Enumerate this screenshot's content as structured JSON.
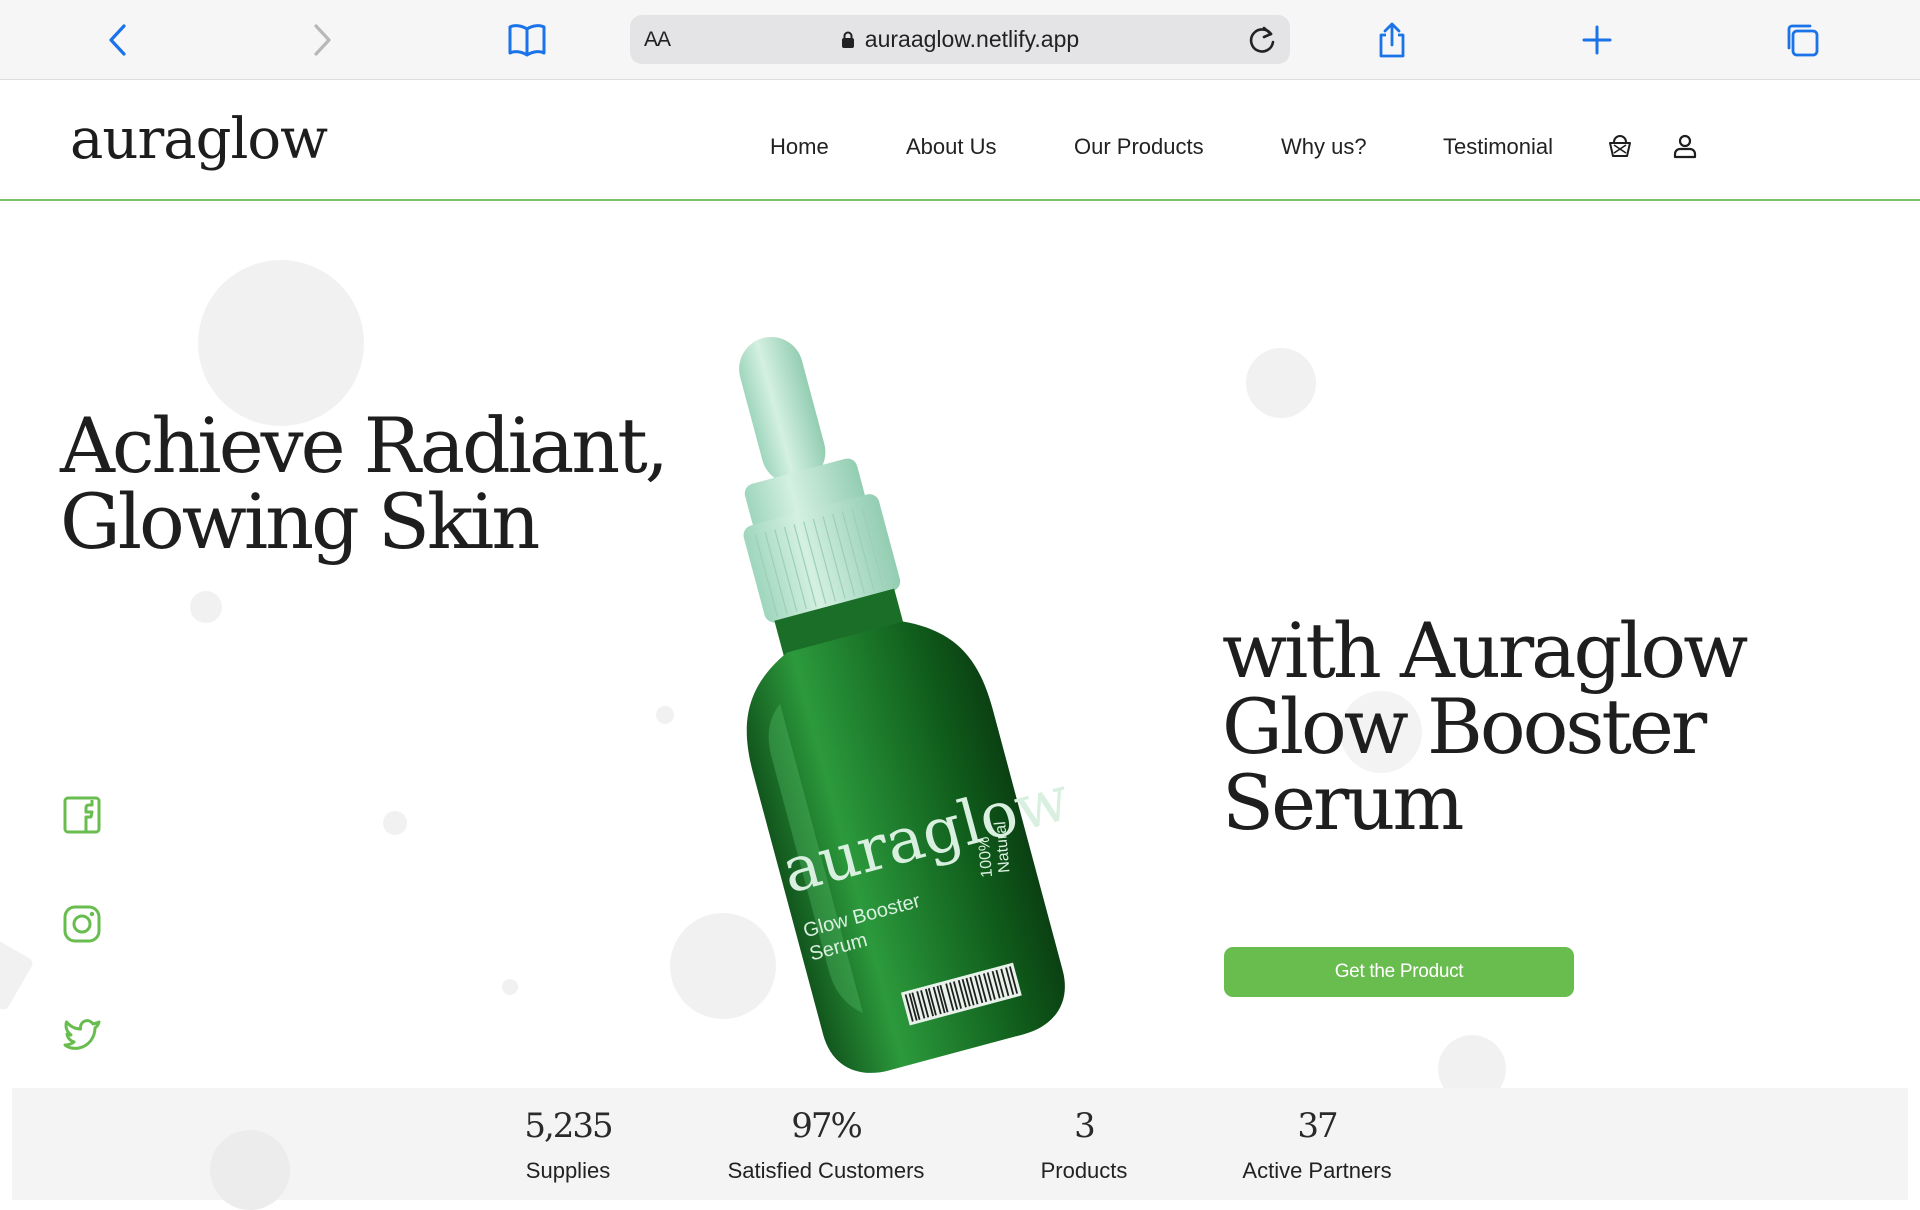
{
  "browser": {
    "url": "auraaglow.netlify.app",
    "reader_label": "AA"
  },
  "header": {
    "logo": "auraglow",
    "nav": [
      "Home",
      "About Us",
      "Our Products",
      "Why us?",
      "Testimonial"
    ]
  },
  "hero": {
    "headline_line1": "Achieve Radiant,",
    "headline_line2": "Glowing Skin",
    "subline_line1": "with Auraglow",
    "subline_line2": "Glow Booster",
    "subline_line3": "Serum",
    "cta_label": "Get the Product",
    "bottle": {
      "brand": "auraglow",
      "product_line1": "Glow Booster",
      "product_line2": "Serum",
      "claim_line1": "100%",
      "claim_line2": "Natural"
    }
  },
  "social": [
    "facebook-icon",
    "instagram-icon",
    "twitter-icon"
  ],
  "stats": [
    {
      "value": "5,235",
      "label": "Supplies"
    },
    {
      "value": "97%",
      "label": "Satisfied Customers"
    },
    {
      "value": "3",
      "label": "Products"
    },
    {
      "value": "37",
      "label": "Active Partners"
    }
  ],
  "colors": {
    "accent": "#69bd4f",
    "bottle": "#1f8a2f",
    "dropper": "#b6e3cf",
    "text": "#1e1e1e"
  }
}
